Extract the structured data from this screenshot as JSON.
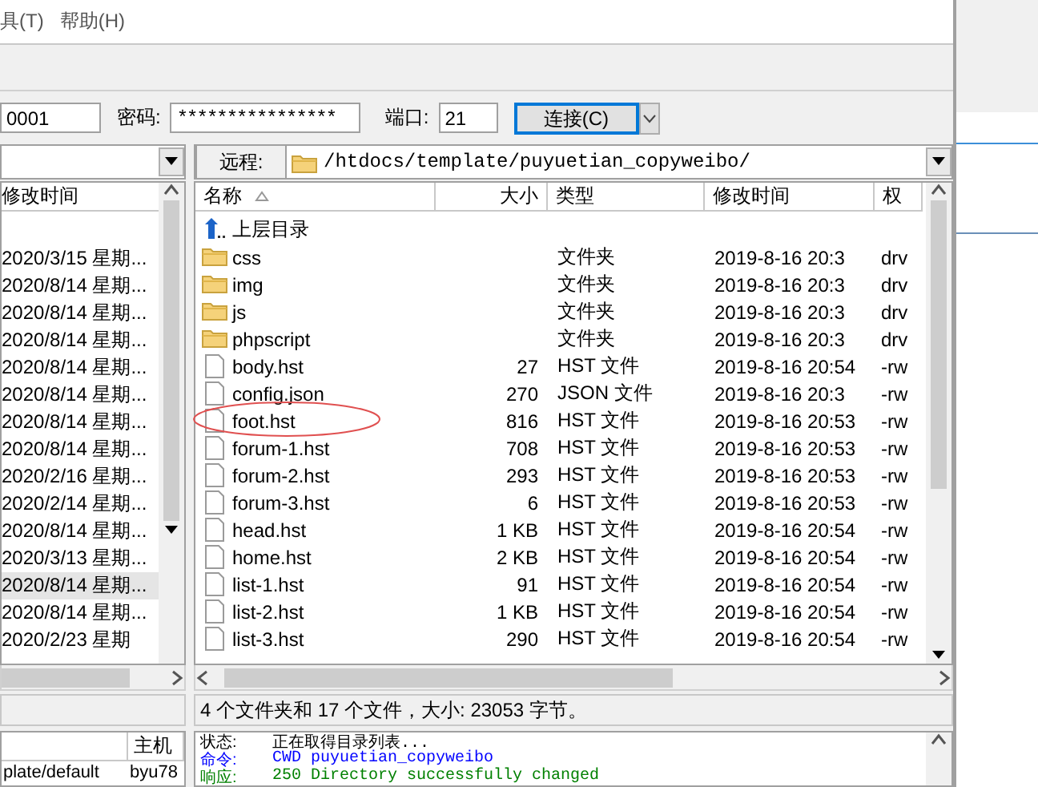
{
  "menu": [
    {
      "label": "具(T)"
    },
    {
      "label": "帮助(H)"
    }
  ],
  "connection": {
    "user_value": "0001",
    "password_label": "密码:",
    "password_value": "****************",
    "port_label": "端口:",
    "port_value": "21",
    "connect_button": "连接(C)"
  },
  "local": {
    "columns": [
      {
        "label": "修改时间"
      }
    ],
    "rows": [
      {
        "modified": "2020/3/15 星期...",
        "selected": false
      },
      {
        "modified": "2020/8/14 星期...",
        "selected": false
      },
      {
        "modified": "2020/8/14 星期...",
        "selected": false
      },
      {
        "modified": "2020/8/14 星期...",
        "selected": false
      },
      {
        "modified": "2020/8/14 星期...",
        "selected": false
      },
      {
        "modified": "2020/8/14 星期...",
        "selected": false
      },
      {
        "modified": "2020/8/14 星期...",
        "selected": false
      },
      {
        "modified": "2020/8/14 星期...",
        "selected": false
      },
      {
        "modified": "2020/2/16 星期...",
        "selected": false
      },
      {
        "modified": "2020/2/14 星期...",
        "selected": false
      },
      {
        "modified": "2020/8/14 星期...",
        "selected": false
      },
      {
        "modified": "2020/3/13 星期...",
        "selected": false
      },
      {
        "modified": "2020/8/14 星期...",
        "selected": true
      },
      {
        "modified": "2020/8/14 星期...",
        "selected": false
      },
      {
        "modified": "2020/2/23 星期",
        "selected": false
      }
    ],
    "queue": {
      "columns": [
        {
          "label": "主机"
        }
      ],
      "rows": [
        {
          "file": "plate/default",
          "host": "byu78"
        }
      ]
    }
  },
  "remote": {
    "label": "远程:",
    "path": "/htdocs/template/puyuetian_copyweibo/",
    "columns": [
      {
        "label": "名称",
        "sorted": true
      },
      {
        "label": "大小",
        "sorted": false
      },
      {
        "label": "类型",
        "sorted": false
      },
      {
        "label": "修改时间",
        "sorted": false
      },
      {
        "label": "权",
        "sorted": false
      }
    ],
    "rows": [
      {
        "kind": "parent",
        "name": "上层目录"
      },
      {
        "kind": "folder",
        "name": "css",
        "type": "文件夹",
        "modified": "2019-8-16 20:3",
        "perms": "drv"
      },
      {
        "kind": "folder",
        "name": "img",
        "type": "文件夹",
        "modified": "2019-8-16 20:3",
        "perms": "drv"
      },
      {
        "kind": "folder",
        "name": "js",
        "type": "文件夹",
        "modified": "2019-8-16 20:3",
        "perms": "drv"
      },
      {
        "kind": "folder",
        "name": "phpscript",
        "type": "文件夹",
        "modified": "2019-8-16 20:3",
        "perms": "drv"
      },
      {
        "kind": "file",
        "name": "body.hst",
        "size": "27",
        "type": "HST 文件",
        "modified": "2019-8-16 20:54",
        "perms": "-rw"
      },
      {
        "kind": "file",
        "name": "config.json",
        "size": "270",
        "type": "JSON 文件",
        "modified": "2019-8-16 20:3",
        "perms": "-rw"
      },
      {
        "kind": "file",
        "name": "foot.hst",
        "size": "816",
        "type": "HST 文件",
        "modified": "2019-8-16 20:53",
        "perms": "-rw"
      },
      {
        "kind": "file",
        "name": "forum-1.hst",
        "size": "708",
        "type": "HST 文件",
        "modified": "2019-8-16 20:53",
        "perms": "-rw"
      },
      {
        "kind": "file",
        "name": "forum-2.hst",
        "size": "293",
        "type": "HST 文件",
        "modified": "2019-8-16 20:53",
        "perms": "-rw"
      },
      {
        "kind": "file",
        "name": "forum-3.hst",
        "size": "6",
        "type": "HST 文件",
        "modified": "2019-8-16 20:53",
        "perms": "-rw"
      },
      {
        "kind": "file",
        "name": "head.hst",
        "size": "1 KB",
        "type": "HST 文件",
        "modified": "2019-8-16 20:54",
        "perms": "-rw"
      },
      {
        "kind": "file",
        "name": "home.hst",
        "size": "2 KB",
        "type": "HST 文件",
        "modified": "2019-8-16 20:54",
        "perms": "-rw"
      },
      {
        "kind": "file",
        "name": "list-1.hst",
        "size": "91",
        "type": "HST 文件",
        "modified": "2019-8-16 20:54",
        "perms": "-rw"
      },
      {
        "kind": "file",
        "name": "list-2.hst",
        "size": "1 KB",
        "type": "HST 文件",
        "modified": "2019-8-16 20:54",
        "perms": "-rw"
      },
      {
        "kind": "file",
        "name": "list-3.hst",
        "size": "290",
        "type": "HST 文件",
        "modified": "2019-8-16 20:54",
        "perms": "-rw"
      }
    ],
    "status": "4 个文件夹和 17 个文件，大小: 23053 字节。",
    "log": [
      {
        "kind": "status",
        "label": "状态:",
        "text": "正在取得目录列表..."
      },
      {
        "kind": "command",
        "label": "命令:",
        "text": "CWD puyuetian_copyweibo"
      },
      {
        "kind": "response",
        "label": "响应:",
        "text": "250 Directory successfully changed"
      }
    ]
  }
}
